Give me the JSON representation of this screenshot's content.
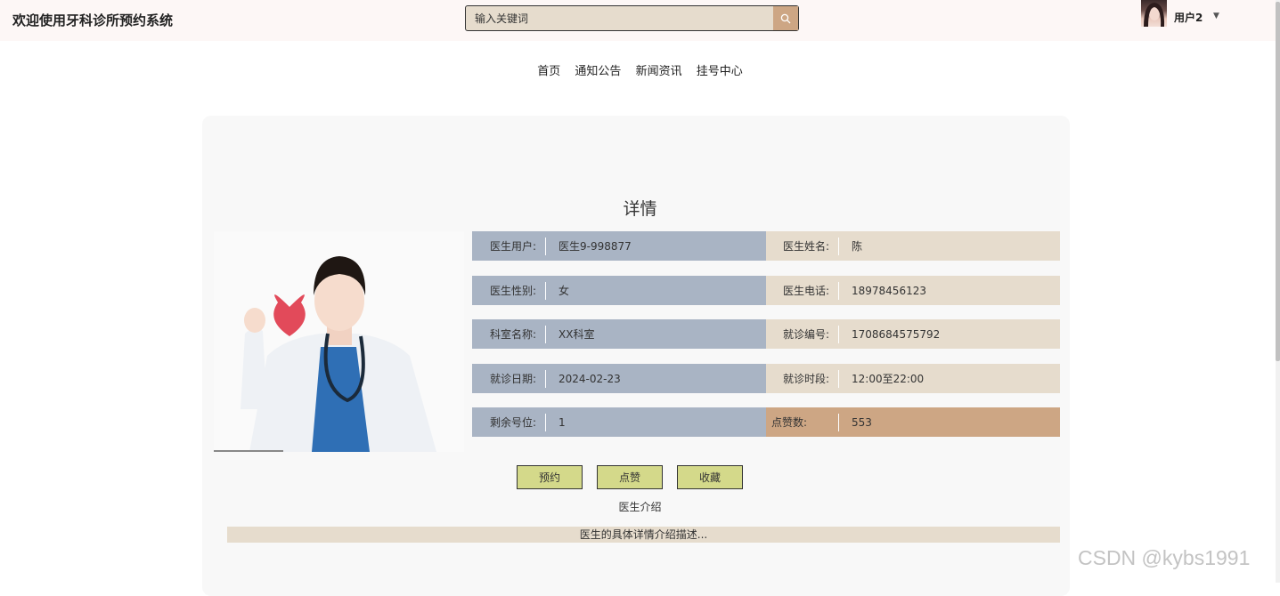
{
  "header": {
    "site_title": "欢迎使用牙科诊所预约系统",
    "search_placeholder": "输入关键词",
    "username": "用户2"
  },
  "nav": [
    "首页",
    "通知公告",
    "新闻资讯",
    "挂号中心"
  ],
  "detail": {
    "title": "详情",
    "fields_left": [
      {
        "label": "医生用户:",
        "value": "医生9-998877"
      },
      {
        "label": "医生性别:",
        "value": "女"
      },
      {
        "label": "科室名称:",
        "value": "XX科室"
      },
      {
        "label": "就诊日期:",
        "value": "2024-02-23"
      },
      {
        "label": "剩余号位:",
        "value": "1"
      }
    ],
    "fields_right": [
      {
        "label": "医生姓名:",
        "value": "陈"
      },
      {
        "label": "医生电话:",
        "value": "18978456123"
      },
      {
        "label": "就诊编号:",
        "value": "1708684575792"
      },
      {
        "label": "就诊时段:",
        "value": "12:00至22:00"
      },
      {
        "label": "点赞数:",
        "value": "553"
      }
    ],
    "buttons": {
      "book": "预约",
      "like": "点赞",
      "favorite": "收藏"
    },
    "intro_title": "医生介绍",
    "intro_content": "医生的具体详情介绍描述..."
  },
  "watermark": "CSDN @kybs1991",
  "colors": {
    "header_bg": "#fdf7f6",
    "search_bg": "#e6dccd",
    "search_btn": "#cda684",
    "row_left": "#a9b4c4",
    "row_right": "#e6dccd",
    "row_highlight": "#cda684",
    "button_bg": "#d4d98a"
  },
  "icons": {
    "search": "search-icon",
    "dropdown": "caret-down-icon",
    "avatar": "user-avatar"
  }
}
